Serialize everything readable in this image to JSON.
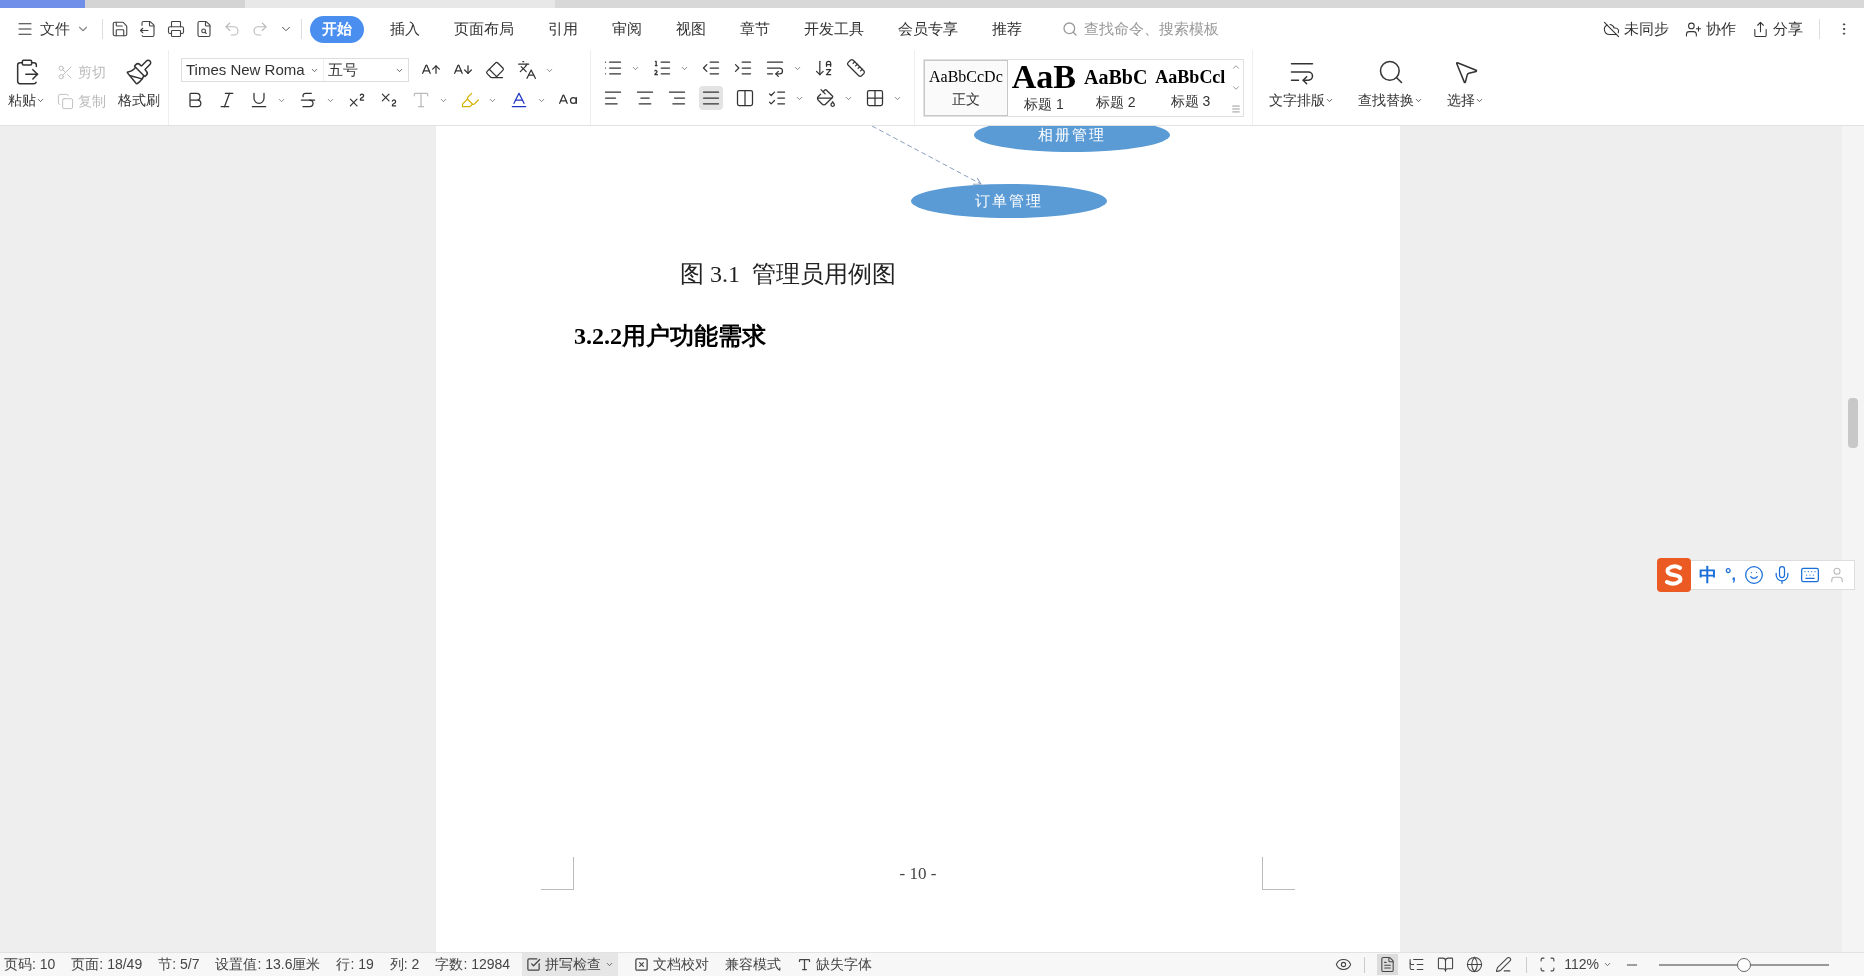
{
  "menu": {
    "file_label": "文件",
    "tabs": [
      {
        "label": "开始",
        "selected": true
      },
      {
        "label": "插入",
        "selected": false
      },
      {
        "label": "页面布局",
        "selected": false
      },
      {
        "label": "引用",
        "selected": false
      },
      {
        "label": "审阅",
        "selected": false
      },
      {
        "label": "视图",
        "selected": false
      },
      {
        "label": "章节",
        "selected": false
      },
      {
        "label": "开发工具",
        "selected": false
      },
      {
        "label": "会员专享",
        "selected": false
      },
      {
        "label": "推荐",
        "selected": false
      }
    ],
    "search_placeholder": "查找命令、搜索模板",
    "actions": [
      "未同步",
      "协作",
      "分享"
    ]
  },
  "ribbon": {
    "paste": "粘贴",
    "cut": {
      "label": "剪切",
      "disabled": true
    },
    "copy": {
      "label": "复制",
      "disabled": true
    },
    "format_painter": "格式刷",
    "font_name": "Times New Roma",
    "font_size": "五号",
    "styles": [
      {
        "preview": "AaBbCcDc",
        "label": "正文",
        "selected": true
      },
      {
        "preview": "AaB",
        "label": "标题 1",
        "selected": false
      },
      {
        "preview": "AaBbC",
        "label": "标题 2",
        "selected": false
      },
      {
        "preview": "AaBbCcl",
        "label": "标题 3",
        "selected": false
      }
    ],
    "text_layout": "文字排版",
    "find_replace": "查找替换",
    "select": "选择"
  },
  "document": {
    "diagram_nodes": [
      "相册管理",
      "订单管理"
    ],
    "caption": "图 3.1  管理员用例图",
    "heading": "3.2.2用户功能需求",
    "page_number": "- 10 -"
  },
  "ime": {
    "mode": "中",
    "punctuation": "°,"
  },
  "status_bar": {
    "items": [
      "页码: 10",
      "页面: 18/49",
      "节: 5/7",
      "设置值: 13.6厘米",
      "行: 19",
      "列: 2",
      "字数: 12984"
    ],
    "spell_check": {
      "label": "拼写检查",
      "checked": true
    },
    "proofread": "文档校对",
    "compat_mode": "兼容模式",
    "missing_fonts": "缺失字体",
    "views": [
      {
        "kind": "page",
        "selected": true
      },
      {
        "kind": "outline",
        "selected": false
      },
      {
        "kind": "reading",
        "selected": false
      },
      {
        "kind": "web",
        "selected": false
      },
      {
        "kind": "write",
        "selected": false
      }
    ],
    "zoom": "112%",
    "zoom_slider": {
      "level": 0.5
    }
  }
}
